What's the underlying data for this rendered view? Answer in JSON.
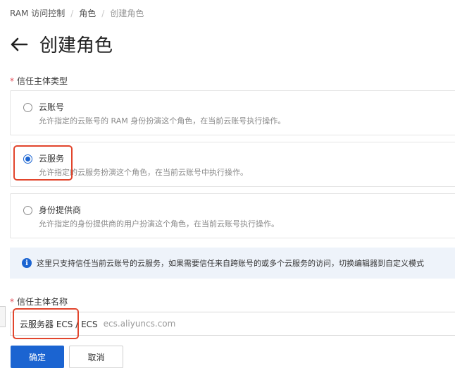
{
  "breadcrumb": {
    "root": "RAM 访问控制",
    "sep1": "/",
    "parent": "角色",
    "sep2": "/",
    "current": "创建角色"
  },
  "header": {
    "title": "创建角色",
    "back_icon": "arrow-left-icon"
  },
  "trust_type": {
    "label": "信任主体类型",
    "required_mark": "*",
    "options": [
      {
        "title": "云账号",
        "desc": "允许指定的云账号的 RAM 身份扮演这个角色，在当前云账号执行操作。",
        "selected": false
      },
      {
        "title": "云服务",
        "desc": "允许指定的云服务扮演这个角色，在当前云账号中执行操作。",
        "selected": true
      },
      {
        "title": "身份提供商",
        "desc": "允许指定的身份提供商的用户扮演这个角色，在当前云账号执行操作。",
        "selected": false
      }
    ]
  },
  "info": {
    "icon": "info-icon",
    "text": "这里只支持信任当前云账号的云服务，如果需要信任来自跨账号的或多个云服务的访问，切换编辑器到自定义模式"
  },
  "trust_name": {
    "label": "信任主体名称",
    "required_mark": "*",
    "value": "云服务器 ECS / ECS",
    "hint": "ecs.aliyuncs.com"
  },
  "actions": {
    "confirm": "确定",
    "cancel": "取消"
  },
  "colors": {
    "primary": "#1b64d1",
    "highlight": "#e2452c",
    "required": "#e34d59",
    "info_bg": "#eef3fa"
  }
}
